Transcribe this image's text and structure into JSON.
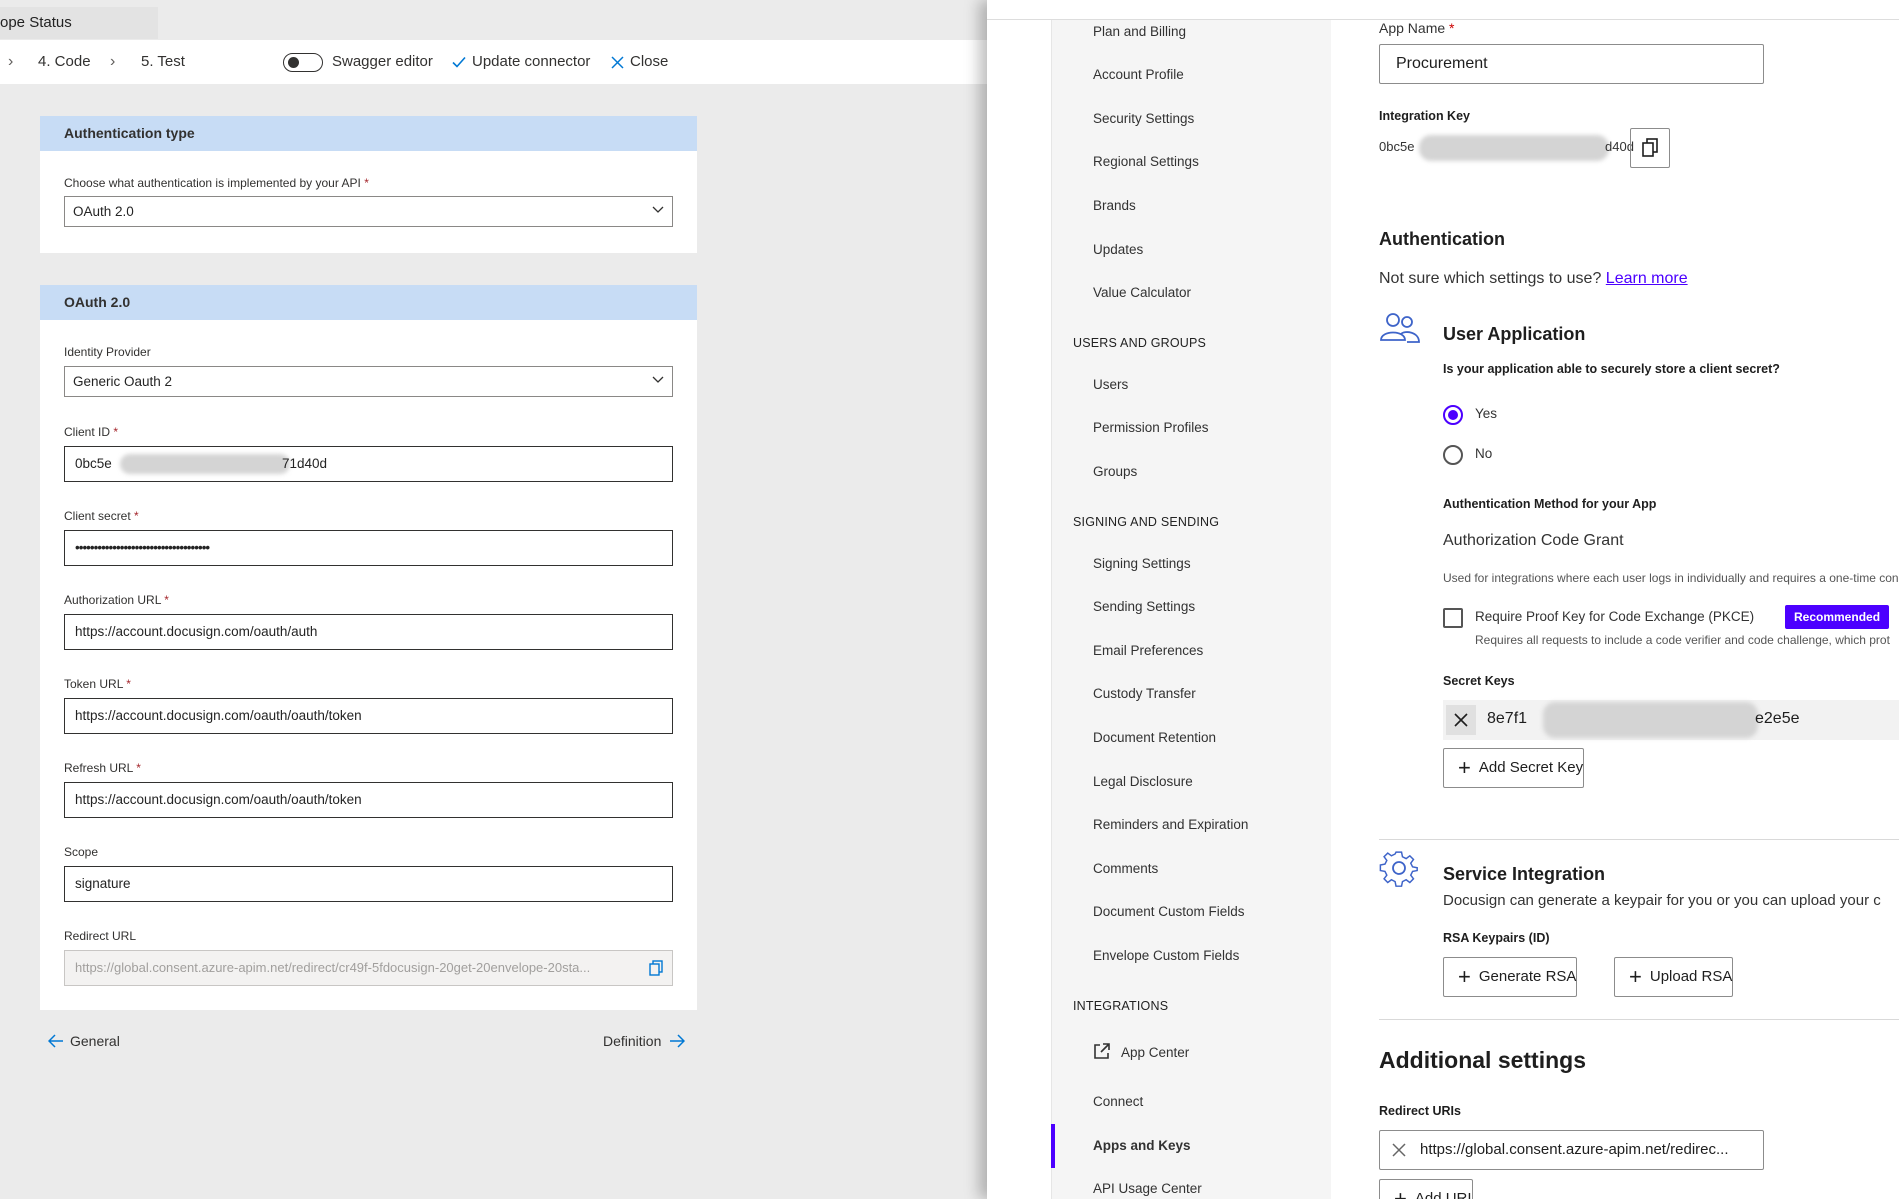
{
  "left": {
    "window_tab": "ope Status",
    "wizard": {
      "step4": "4. Code",
      "step5": "5. Test"
    },
    "toolbar": {
      "swagger_label": "Swagger editor",
      "update_label": "Update connector",
      "close_label": "Close"
    },
    "auth_card": {
      "header": "Authentication type",
      "label": "Choose what authentication is implemented by your API",
      "value": "OAuth 2.0"
    },
    "oauth_card": {
      "header": "OAuth 2.0",
      "identity_provider_label": "Identity Provider",
      "identity_provider_value": "Generic Oauth 2",
      "client_id_label": "Client ID",
      "client_id_start": "0bc5e",
      "client_id_end": "71d40d",
      "client_secret_label": "Client secret",
      "client_secret_value": "••••••••••••••••••••••••••••••••••••",
      "auth_url_label": "Authorization URL",
      "auth_url_value": "https://account.docusign.com/oauth/auth",
      "token_url_label": "Token URL",
      "token_url_value": "https://account.docusign.com/oauth/oauth/token",
      "refresh_url_label": "Refresh URL",
      "refresh_url_value": "https://account.docusign.com/oauth/oauth/token",
      "scope_label": "Scope",
      "scope_value": "signature",
      "redirect_url_label": "Redirect URL",
      "redirect_url_value": "https://global.consent.azure-apim.net/redirect/cr49f-5fdocusign-20get-20envelope-20sta..."
    },
    "footer": {
      "back_label": "General",
      "next_label": "Definition"
    }
  },
  "right": {
    "nav": {
      "top_items": [
        "Plan and Billing",
        "Account Profile",
        "Security Settings",
        "Regional Settings",
        "Brands",
        "Updates",
        "Value Calculator"
      ],
      "users_section": "USERS AND GROUPS",
      "users_items": [
        "Users",
        "Permission Profiles",
        "Groups"
      ],
      "signing_section": "SIGNING AND SENDING",
      "signing_items": [
        "Signing Settings",
        "Sending Settings",
        "Email Preferences",
        "Custody Transfer",
        "Document Retention",
        "Legal Disclosure",
        "Reminders and Expiration",
        "Comments",
        "Document Custom Fields",
        "Envelope Custom Fields"
      ],
      "integrations_section": "INTEGRATIONS",
      "app_center": "App Center",
      "connect": "Connect",
      "apps_and_keys": "Apps and Keys",
      "api_usage": "API Usage Center"
    },
    "main": {
      "app_name_label": "App Name",
      "app_name_value": "Procurement",
      "integration_key_label": "Integration Key",
      "integration_key_start": "0bc5e",
      "integration_key_end": "d40d",
      "authentication_heading": "Authentication",
      "not_sure_text": "Not sure which settings to use?",
      "learn_more": "Learn more",
      "user_app_heading": "User Application",
      "secret_question": "Is your application able to securely store a client secret?",
      "yes_label": "Yes",
      "no_label": "No",
      "auth_method_label": "Authentication Method for your App",
      "auth_method_value": "Authorization Code Grant",
      "auth_method_desc": "Used for integrations where each user logs in individually and requires a one-time conse",
      "pkce_label": "Require Proof Key for Code Exchange (PKCE)",
      "recommended_badge": "Recommended",
      "pkce_desc": "Requires all requests to include a code verifier and code challenge, which prot",
      "secret_keys_label": "Secret Keys",
      "secret_key_start": "8e7f1",
      "secret_key_end": "e2e5e",
      "add_secret_key": "Add Secret Key",
      "service_integration_heading": "Service Integration",
      "service_integration_desc": "Docusign can generate a keypair for you or you can upload your c",
      "rsa_label": "RSA Keypairs (ID)",
      "generate_rsa": "Generate RSA",
      "upload_rsa": "Upload RSA",
      "additional_heading": "Additional settings",
      "redirect_uris_label": "Redirect URIs",
      "redirect_uri_value": "https://global.consent.azure-apim.net/redirec...",
      "add_uri": "Add URI"
    }
  },
  "colors": {
    "card_header": "#c7dcf5",
    "docusign_accent": "#4c00ff",
    "docusign_link": "#4c00ff"
  }
}
